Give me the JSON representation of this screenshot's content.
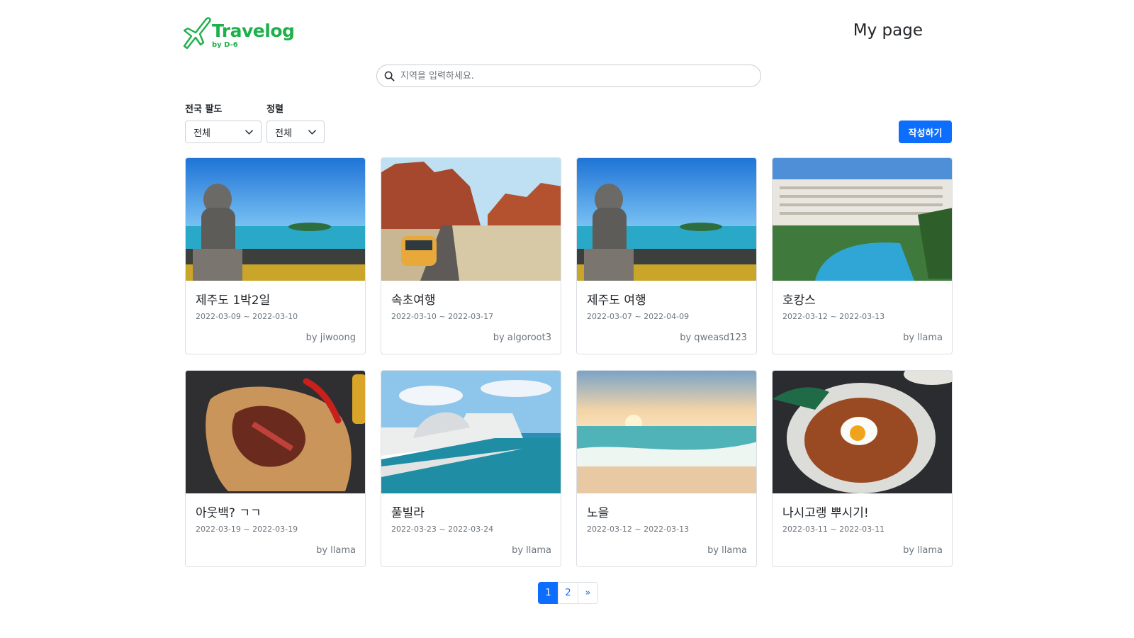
{
  "header": {
    "logo_title": "Travelog",
    "logo_sub": "by D-6",
    "mypage_label": "My page"
  },
  "search": {
    "placeholder": "지역을 입력하세요."
  },
  "filters": {
    "region_label": "전국 팔도",
    "region_value": "전체",
    "sort_label": "정렬",
    "sort_value": "전체"
  },
  "write_button": "작성하기",
  "cards": [
    {
      "title": "제주도 1박2일",
      "dates": "2022-03-09 ~ 2022-03-10",
      "author": "by jiwoong",
      "image": "jeju-harubang"
    },
    {
      "title": "속초여행",
      "dates": "2022-03-10 ~ 2022-03-17",
      "author": "by algoroot3",
      "image": "desert-road-van"
    },
    {
      "title": "제주도 여행",
      "dates": "2022-03-07 ~ 2022-04-09",
      "author": "by qweasd123",
      "image": "jeju-harubang"
    },
    {
      "title": "호캉스",
      "dates": "2022-03-12 ~ 2022-03-13",
      "author": "by llama",
      "image": "resort-pool"
    },
    {
      "title": "아웃백? ㄱㄱ",
      "dates": "2022-03-19 ~ 2022-03-19",
      "author": "by llama",
      "image": "steak"
    },
    {
      "title": "풀빌라",
      "dates": "2022-03-23 ~ 2022-03-24",
      "author": "by llama",
      "image": "infinity-pool"
    },
    {
      "title": "노을",
      "dates": "2022-03-12 ~ 2022-03-13",
      "author": "by llama",
      "image": "sunset-beach"
    },
    {
      "title": "나시고랭 뿌시기!",
      "dates": "2022-03-11 ~ 2022-03-11",
      "author": "by llama",
      "image": "nasi-goreng"
    }
  ],
  "pagination": {
    "pages": [
      "1",
      "2"
    ],
    "next": "»",
    "current": "1"
  },
  "colors": {
    "accent": "#0d6efd",
    "brand": "#1eb04b"
  }
}
